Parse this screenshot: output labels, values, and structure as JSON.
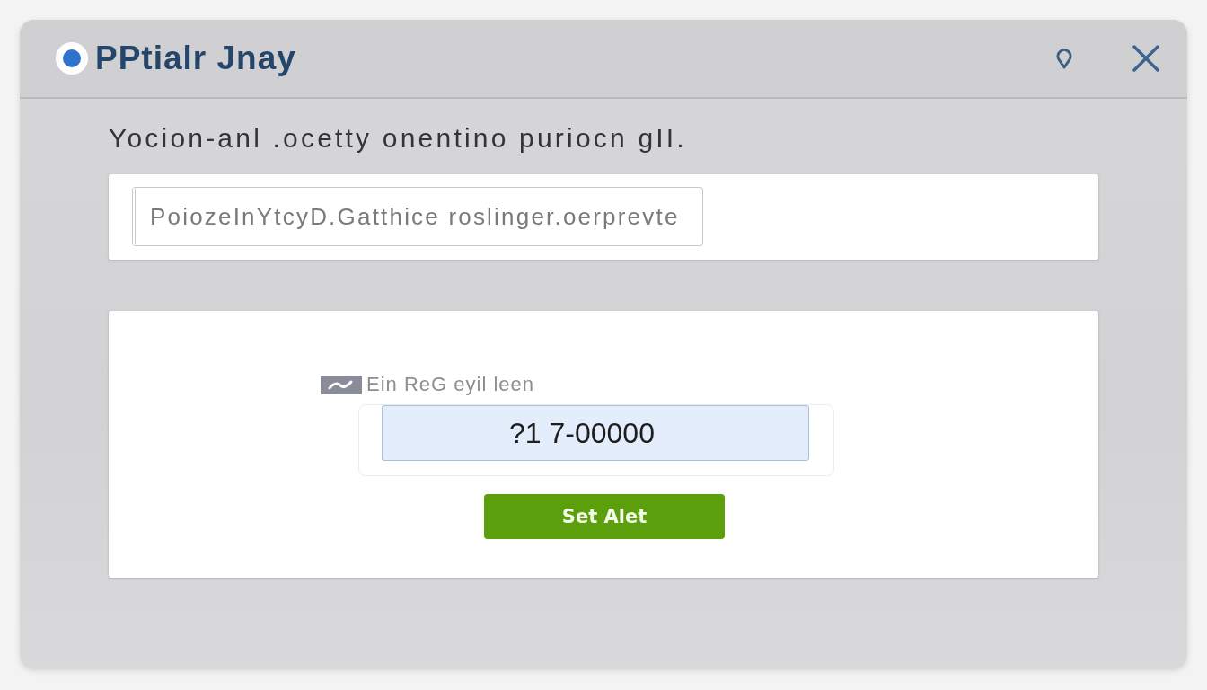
{
  "window": {
    "title": "PPtialr Jnay"
  },
  "subtitle": "Yocion-anl .ocetty onentino puriocn gII.",
  "search": {
    "placeholder": "PoiozeInYtcyD.Gatthice roslinger.oerprevte"
  },
  "alert_form": {
    "label": "Ein ReG eyil leen",
    "value": "?1 7-00000",
    "button": "Set Alet"
  }
}
